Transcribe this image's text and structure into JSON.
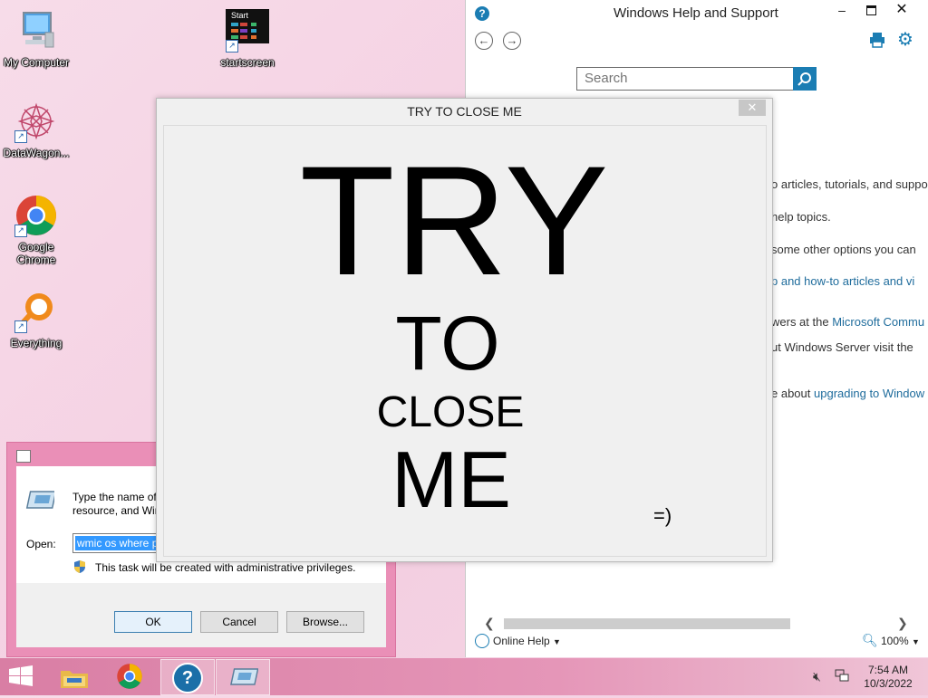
{
  "desktop": {
    "icons": [
      {
        "label": "My Computer"
      },
      {
        "label": "startscreen",
        "badge": "Start"
      },
      {
        "label": "DataWagon..."
      },
      {
        "label": "Google Chrome"
      },
      {
        "label": "Everything"
      }
    ]
  },
  "help_window": {
    "title": "Windows Help and Support",
    "search_placeholder": "Search",
    "content_lines": [
      {
        "text": "o articles, tutorials, and suppo",
        "link": ""
      },
      {
        "text": "help topics.",
        "link": ""
      },
      {
        "text": " some other options you can",
        "link": ""
      },
      {
        "text": "",
        "link": "p and how-to articles and vi"
      },
      {
        "text": "wers at the ",
        "link": "Microsoft Commu"
      },
      {
        "text": "ut Windows Server visit the",
        "link": ""
      },
      {
        "text": "e about ",
        "link": "upgrading to Window"
      }
    ],
    "status": {
      "online_help": "Online Help",
      "zoom": "100%"
    }
  },
  "try_window": {
    "title": "TRY TO CLOSE ME",
    "word1": "TRY",
    "word2": "TO",
    "word3": "CLOSE",
    "word4": "ME",
    "smiley": "=)"
  },
  "run_dialog": {
    "description_line1": "Type the name of",
    "description_line2": "resource, and Win",
    "open_label": "Open:",
    "open_value": "wmic os where p",
    "admin_note": "This task will be created with administrative privileges.",
    "ok_label": "OK",
    "cancel_label": "Cancel",
    "browse_label": "Browse..."
  },
  "taskbar": {
    "time": "7:54 AM",
    "date": "10/3/2022"
  },
  "colors": {
    "taskbar": "#dc86ab",
    "accent_blue": "#1b7db3",
    "run_frame": "#ea8fb7"
  }
}
